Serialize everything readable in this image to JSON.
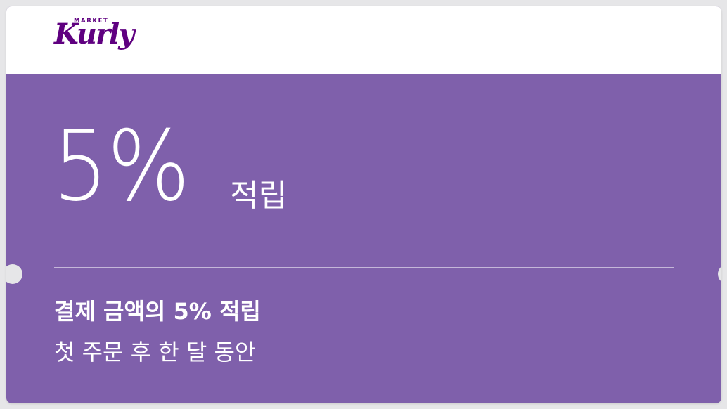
{
  "brand": {
    "logo_small": "MARKET",
    "logo_main": "Kurly"
  },
  "coupon": {
    "value": "5%",
    "value_suffix": "적립",
    "description_line1": "결제 금액의 5% 적립",
    "description_line2": "첫 주문 후 한 달 동안"
  },
  "colors": {
    "accent": "#7f60ab",
    "brand": "#5f0080",
    "header_bg": "#ffffff",
    "page_bg": "#e6e6e8"
  }
}
